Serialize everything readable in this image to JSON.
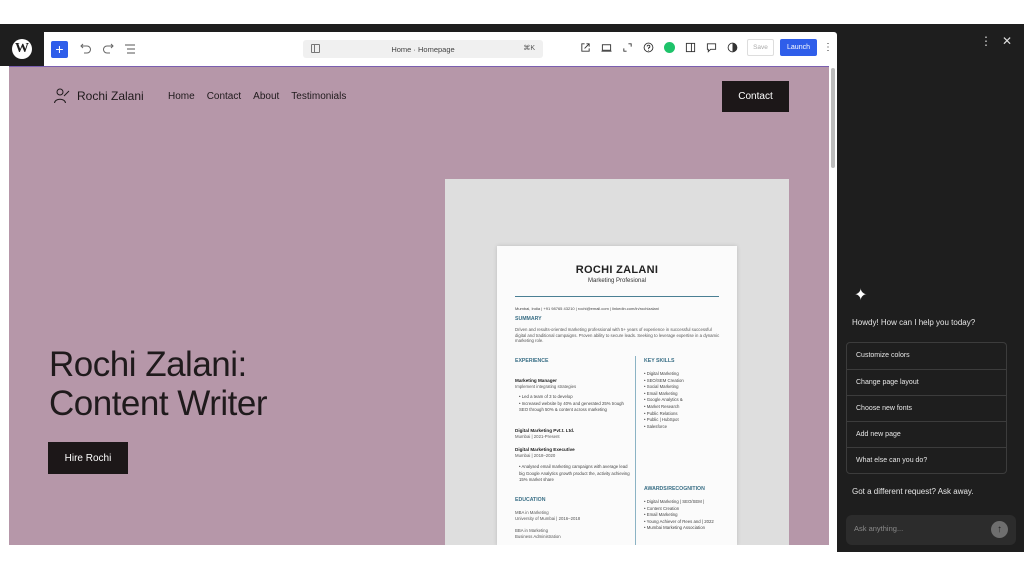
{
  "toolbar": {
    "wp_logo_letter": "W",
    "add_label": "+",
    "command_title": "Home · Homepage",
    "command_shortcut": "⌘K",
    "save_label": "Save",
    "launch_label": "Launch",
    "more_label": "⋮",
    "accent_color": "#2f5eea"
  },
  "site": {
    "logo_name": "Rochi Zalani",
    "nav": [
      "Home",
      "Contact",
      "About",
      "Testimonials"
    ],
    "contact_button": "Contact",
    "hero_title_line1": "Rochi Zalani:",
    "hero_title_line2": "Content Writer",
    "hire_button": "Hire Rochi",
    "background_color": "#b697a9"
  },
  "resume": {
    "name": "ROCHI ZALANI",
    "role": "Marketing Profesional",
    "contact": "Mumbai, India | +91 98765 43210 | rochi@email.com | linkedin.com/in/rochizalani",
    "summary_heading": "SUMMARY",
    "summary_text": "Driven and results-oriented marketing professional with 5+ years of experience in successful successful digital and traditional campaigns. Proven ability to secure leads. Seeking to leverage expertise in a dynamic marketing role.",
    "experience_heading": "EXPERIENCE",
    "job1_title": "Marketing Manager",
    "job1_sub": "Implement integrating strategies",
    "job1_bullets": [
      "Led a team of 3 to develop",
      "Increased website by 40% and generated 25% trough SEO through 50% & content across marketing"
    ],
    "job2_title": "Digital Marketing Pvt.t. Ltd.",
    "job2_sub": "Mumbai | 2021-Present",
    "job3_title": "Digital Marketing Executive",
    "job3_sub": "Mumbai | 2018–2020",
    "job3_bullets": [
      "Analysed email marketing campaigns with average lead big Google Analytics growth product the, activity achieving 15% market share"
    ],
    "education_heading": "EDUCATION",
    "edu1": "MBA in Marketing",
    "edu1_sub": "University of Mumbai | 2016–2018",
    "edu2": "BBA in Marketing",
    "edu2_sub": "Business Administration",
    "skills_heading": "KEY SKILLS",
    "skills": [
      "Digital Marketing",
      "SEO/SEM Creation",
      "Social Marketing",
      "Email Marketing",
      "Google Analytics &",
      "Market Research",
      "Public Relations",
      "Public | HubSpot",
      "Salesforce"
    ],
    "awards_heading": "AWARDS/RECOGNITION",
    "awards": [
      "Digital Marketing | SEO/SEM |",
      "Content Creation",
      "Email Marketing",
      "Young Achiever of Rees and | 2022",
      "Mumbai Marketing Association"
    ]
  },
  "panel": {
    "more_label": "⋮",
    "close_label": "✕",
    "sparkle": "✦",
    "greeting": "Howdy! How can I help you today?",
    "suggestions": [
      "Customize colors",
      "Change page layout",
      "Choose new fonts",
      "Add new page",
      "What else can you do?"
    ],
    "different_request": "Got a different request? Ask away.",
    "ask_placeholder": "Ask anything...",
    "send_label": "↑"
  }
}
